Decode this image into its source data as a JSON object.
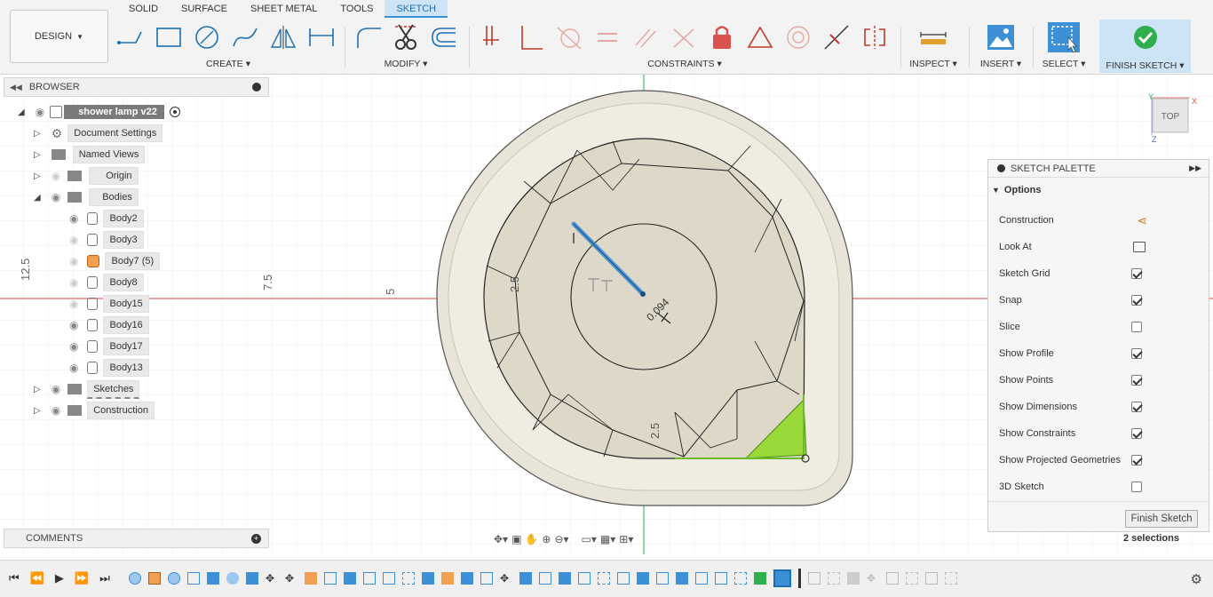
{
  "toolbar": {
    "design_label": "DESIGN",
    "tabs": [
      "SOLID",
      "SURFACE",
      "SHEET METAL",
      "TOOLS",
      "SKETCH"
    ],
    "active_tab": "SKETCH",
    "groups": {
      "create": "CREATE",
      "modify": "MODIFY",
      "constraints": "CONSTRAINTS",
      "inspect": "INSPECT",
      "insert": "INSERT",
      "select": "SELECT",
      "finish": "FINISH SKETCH"
    }
  },
  "browser": {
    "title": "BROWSER",
    "root": "shower lamp v22",
    "items": [
      {
        "label": "Document Settings"
      },
      {
        "label": "Named Views"
      },
      {
        "label": "Origin"
      },
      {
        "label": "Bodies"
      },
      {
        "label": "Body2"
      },
      {
        "label": "Body3"
      },
      {
        "label": "Body7 (5)"
      },
      {
        "label": "Body8"
      },
      {
        "label": "Body15"
      },
      {
        "label": "Body16"
      },
      {
        "label": "Body17"
      },
      {
        "label": "Body13"
      },
      {
        "label": "Sketches"
      },
      {
        "label": "Construction"
      }
    ]
  },
  "comments": {
    "title": "COMMENTS"
  },
  "viewcube": {
    "label": "TOP",
    "axis_x": "X",
    "axis_y": "Y",
    "axis_z": "Z"
  },
  "canvas_labels": {
    "left_dim": "12.5",
    "dim_75": "7.5",
    "dim_5": "5",
    "dim_25_top": "2.5",
    "dim_25_bottom": "2.5",
    "dim_small": "0.094"
  },
  "sketch_palette": {
    "title": "SKETCH PALETTE",
    "section": "Options",
    "options": [
      {
        "label": "Construction",
        "type": "icon"
      },
      {
        "label": "Look At",
        "type": "icon"
      },
      {
        "label": "Sketch Grid",
        "checked": true
      },
      {
        "label": "Snap",
        "checked": true
      },
      {
        "label": "Slice",
        "checked": false
      },
      {
        "label": "Show Profile",
        "checked": true
      },
      {
        "label": "Show Points",
        "checked": true
      },
      {
        "label": "Show Dimensions",
        "checked": true
      },
      {
        "label": "Show Constraints",
        "checked": true
      },
      {
        "label": "Show Projected Geometries",
        "checked": true
      },
      {
        "label": "3D Sketch",
        "checked": false
      }
    ],
    "finish_button": "Finish Sketch"
  },
  "status": {
    "selections": "2 selections"
  },
  "colors": {
    "accent": "#3d8fd6",
    "finish_bg": "#cde4f7",
    "profile_fill": "#9ad93a",
    "lamp_body": "#e8e4d8"
  }
}
